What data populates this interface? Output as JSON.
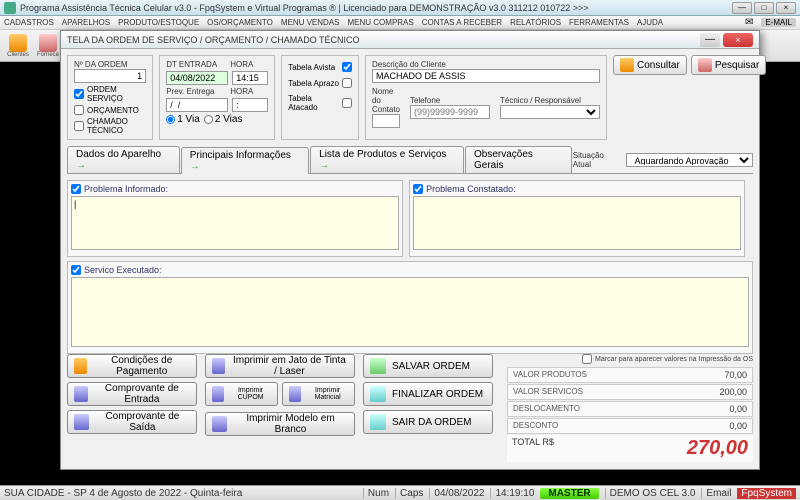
{
  "app": {
    "title": "Programa Assistência Técnica Celular v3.0 - FpqSystem e Virtual Programas ® | Licenciado para  DEMONSTRAÇÃO v3.0 311212 010722 >>>"
  },
  "menu": [
    "CADASTROS",
    "APARELHOS",
    "PRODUTO/ESTOQUE",
    "OS/ORÇAMENTO",
    "MENU VENDAS",
    "MENU COMPRAS",
    "CONTAS A RECEBER",
    "RELATÓRIOS",
    "FERRAMENTAS",
    "AJUDA"
  ],
  "email_label": "E-MAIL",
  "toolbar_labels": [
    "Clientes",
    "Fornece"
  ],
  "dialog": {
    "title": "TELA DA ORDEM DE SERVIÇO / ORÇAMENTO / CHAMADO TÉCNICO",
    "ordem_label": "Nº DA ORDEM",
    "ordem_value": "1",
    "chk_ordem": "ORDEM SERVIÇO",
    "chk_orc": "ORÇAMENTO",
    "chk_chamado": "CHAMADO TÉCNICO",
    "entrada_label": "DT ENTRADA",
    "hora_label": "HORA",
    "entrada_value": "04/08/2022",
    "entrada_hora": "14:15",
    "prev_label": "Prev. Entrega",
    "prev_value": "/  /",
    "prev_hora": ":",
    "via1": "1 Via",
    "via2": "2 Vias",
    "tabela_avista": "Tabela Avista",
    "tabela_aprazo": "Tabela Aprazo",
    "tabela_atacado": "Tabela Atacado",
    "desc_cliente_label": "Descrição do Cliente",
    "desc_cliente_value": "MACHADO DE ASSIS",
    "nome_contato_label": "Nome do Contato",
    "telefone_label": "Telefone",
    "telefone_ph": "(99)99999-9999",
    "tecnico_label": "Técnico / Responsável",
    "btn_consultar": "Consultar",
    "btn_pesquisar": "Pesquisar",
    "tabs": [
      "Dados do Aparelho",
      "Principais Informações",
      "Lista de Produtos e Serviços",
      "Observações Gerais"
    ],
    "situacao_label": "Situação Atual",
    "situacao_value": "Aguardando Aprovação",
    "problema_informado": "Problema Informado:",
    "problema_constatado": "Problema Constatado:",
    "servico_executado": "Servico Executado:",
    "btn_cond": "Condições de Pagamento",
    "btn_jato": "Imprimir em Jato de Tinta / Laser",
    "btn_salvar": "SALVAR ORDEM",
    "btn_comp_ent": "Comprovante de Entrada",
    "btn_cupom": "Imprimir CUPOM",
    "btn_matricial": "Imprimir Matricial",
    "btn_finalizar": "FINALIZAR ORDEM",
    "btn_comp_saida": "Comprovante de Saída",
    "btn_branco": "Imprimir Modelo em Branco",
    "btn_sair": "SAIR DA ORDEM",
    "marcar": "Marcar para aparecer valores na Impressão da OS",
    "valor_produtos_lbl": "VALOR PRODUTOS",
    "valor_produtos": "70,00",
    "valor_servicos_lbl": "VALOR SERVICOS",
    "valor_servicos": "200,00",
    "deslocamento_lbl": "DESLOCAMENTO",
    "deslocamento": "0,00",
    "desconto_lbl": "DESCONTO",
    "desconto": "0,00",
    "total_lbl": "TOTAL R$",
    "total": "270,00"
  },
  "status": {
    "local": "SUA CIDADE - SP  4 de Agosto de 2022 - Quinta-feira",
    "num": "Num",
    "caps": "Caps",
    "date": "04/08/2022",
    "time": "14:19:10",
    "master": "MASTER",
    "demo": "DEMO OS CEL 3.0",
    "email": "Email",
    "fpq": "FpqSystem"
  }
}
